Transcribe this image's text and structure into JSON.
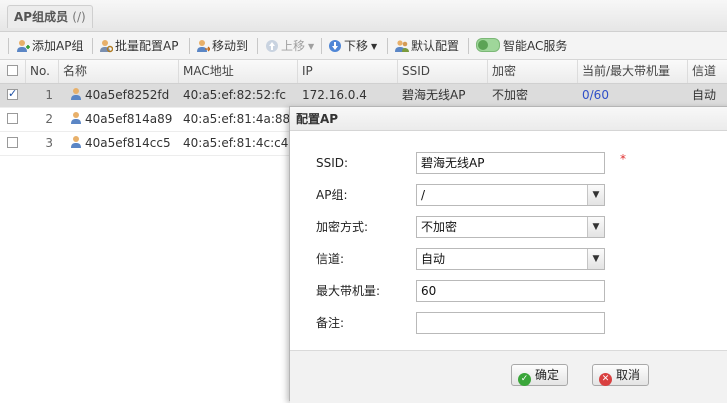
{
  "panel": {
    "title": "AP组成员",
    "title_suffix": "(/)"
  },
  "toolbar": {
    "add_group": "添加AP组",
    "batch_config": "批量配置AP",
    "move_to": "移动到",
    "move_up": "上移",
    "move_down": "下移",
    "default_config": "默认配置",
    "smart_ac": "智能AC服务"
  },
  "grid": {
    "columns": {
      "no": "No.",
      "name": "名称",
      "mac": "MAC地址",
      "ip": "IP",
      "ssid": "SSID",
      "encryption": "加密",
      "bandwidth": "当前/最大带机量",
      "channel": "信道"
    },
    "rows": [
      {
        "no": "1",
        "name": "40a5ef8252fd",
        "mac": "40:a5:ef:82:52:fc",
        "ip": "172.16.0.4",
        "ssid": "碧海无线AP",
        "encryption": "不加密",
        "bandwidth": "0/60",
        "channel": "自动",
        "checked": true
      },
      {
        "no": "2",
        "name": "40a5ef814a89",
        "mac": "40:a5:ef:81:4a:88",
        "checked": false
      },
      {
        "no": "3",
        "name": "40a5ef814cc5",
        "mac": "40:a5:ef:81:4c:c4",
        "checked": false
      }
    ]
  },
  "dialog": {
    "title": "配置AP",
    "fields": {
      "ssid_label": "SSID:",
      "ssid_value": "碧海无线AP",
      "group_label": "AP组:",
      "group_value": "/",
      "enc_label": "加密方式:",
      "enc_value": "不加密",
      "channel_label": "信道:",
      "channel_value": "自动",
      "max_label": "最大带机量:",
      "max_value": "60",
      "note_label": "备注:",
      "note_value": ""
    },
    "required_mark": "*",
    "ok_label": "确定",
    "cancel_label": "取消"
  },
  "colors": {
    "selected_row": "#dcdcdc",
    "link": "#2f4fc8",
    "required": "#e03030"
  }
}
